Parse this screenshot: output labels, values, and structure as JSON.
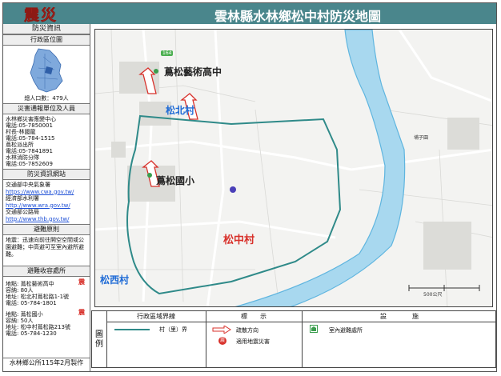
{
  "header": {
    "logo_text": "震災",
    "title": "雲林縣水林鄉松中村防災地圖"
  },
  "sidebar": {
    "info_title": "防災資訊",
    "location_title": "行政區位圖",
    "population": "總人口數：479人",
    "contacts_title": "災害通報單位及人員",
    "contacts": [
      "水林鄉災害應變中心",
      "電話:05-7850001",
      "村長-林國龍",
      "電話:05-784-1515",
      "蔦松派出所",
      "電話:05-7841891",
      "水林消防分隊",
      "電話:05-7852609"
    ],
    "websites_title": "防災資訊網站",
    "websites": [
      {
        "label": "交通部中央氣象署",
        "url": "https://www.cwa.gov.tw/"
      },
      {
        "label": "經濟部水利署",
        "url": "http://www.wra.gov.tw/"
      },
      {
        "label": "交通部公路局",
        "url": "http://www.thb.gov.tw/"
      }
    ],
    "principle_title": "避難原則",
    "principle_text": "地震：迅速向前往開空空間或公園避難；中高避可至室內避所避難。",
    "shelters_title": "避難收容處所",
    "shelters": [
      {
        "name": "地點: 蔦松藝術高中",
        "capacity": "容納: 80人",
        "address": "地址: 松北村蔦松路1-1號",
        "phone": "電話: 05-784-1801",
        "badge": "震"
      },
      {
        "name": "地點: 蔦松國小",
        "capacity": "容納: 50人",
        "address": "地址: 松中村蔦松路213號",
        "phone": "電話: 05-784-1230",
        "badge": "震"
      }
    ],
    "footer": "水林鄉公所115年2月製作"
  },
  "map": {
    "labels": {
      "school_high": "蔦松藝術高中",
      "school_elem": "蔦松國小",
      "village_north": "松北村",
      "village_center": "松中村",
      "village_west": "松西村",
      "road_number": "164",
      "place_small": "埔子園",
      "scale_label": "500公尺"
    },
    "colors": {
      "river": "#a8d8ef",
      "river_edge": "#5fb5df",
      "boundary": "#2f8a89",
      "arrow": "#d8312b",
      "village_red": "#d8312b",
      "village_blue": "#1f6bd6"
    }
  },
  "legend": {
    "tu_label": "圖例",
    "col_boundary": "行政區域界線",
    "col_mark": "標　　示",
    "col_facility": "設　　　　施",
    "boundary_item": "村（里）界",
    "mark_arrow": "疏散方向",
    "mark_shelter": "適用地震災害",
    "shelter_badge": "震",
    "facility_item": "室內避難處所"
  }
}
